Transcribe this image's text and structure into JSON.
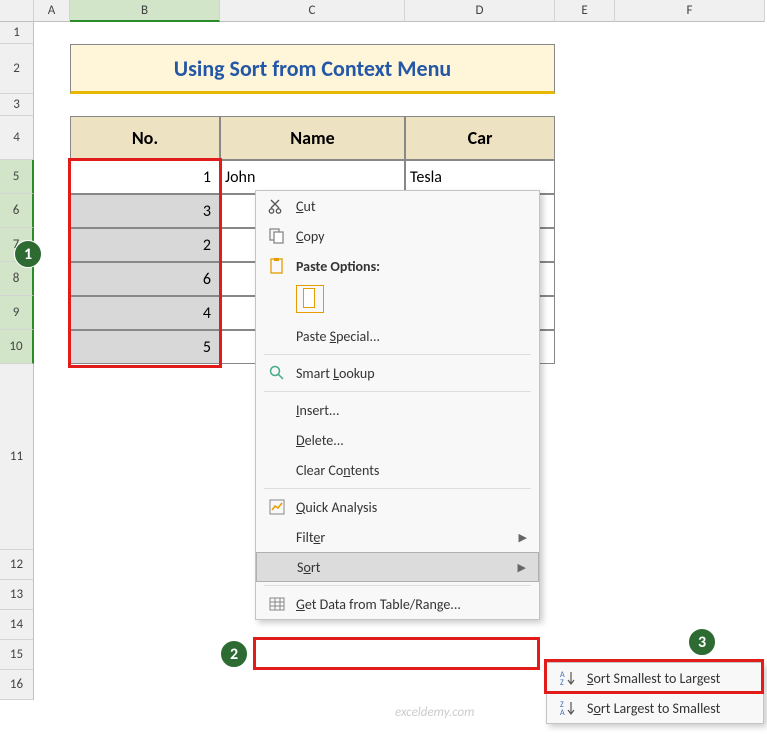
{
  "columns": [
    {
      "label": "",
      "w": 34
    },
    {
      "label": "A",
      "w": 36
    },
    {
      "label": "B",
      "w": 150,
      "sel": true
    },
    {
      "label": "C",
      "w": 185
    },
    {
      "label": "D",
      "w": 150
    },
    {
      "label": "E",
      "w": 60
    },
    {
      "label": "F",
      "w": 150
    }
  ],
  "rows": [
    {
      "n": 1,
      "h": 22
    },
    {
      "n": 2,
      "h": 50
    },
    {
      "n": 3,
      "h": 22
    },
    {
      "n": 4,
      "h": 44
    },
    {
      "n": 5,
      "h": 34,
      "sel": true
    },
    {
      "n": 6,
      "h": 34,
      "sel": true
    },
    {
      "n": 7,
      "h": 34,
      "sel": true
    },
    {
      "n": 8,
      "h": 34,
      "sel": true
    },
    {
      "n": 9,
      "h": 34,
      "sel": true
    },
    {
      "n": 10,
      "h": 34,
      "sel": true
    },
    {
      "n": 11,
      "h": 186
    },
    {
      "n": 12,
      "h": 30
    },
    {
      "n": 13,
      "h": 30
    },
    {
      "n": 14,
      "h": 30
    },
    {
      "n": 15,
      "h": 30
    },
    {
      "n": 16,
      "h": 30
    }
  ],
  "title": "Using Sort from Context Menu",
  "headers": {
    "no": "No.",
    "name": "Name",
    "car": "Car"
  },
  "data": {
    "nums": [
      1,
      3,
      2,
      6,
      4,
      5
    ],
    "names": [
      "John"
    ],
    "cars": [
      "Tesla"
    ]
  },
  "ctx": {
    "cut": "Cut",
    "copy": "Copy",
    "pasteopt": "Paste Options:",
    "pastespecial": "Paste Special...",
    "smartlookup": "Smart Lookup",
    "insert": "Insert...",
    "delete": "Delete...",
    "clear": "Clear Contents",
    "quick": "Quick Analysis",
    "filter": "Filter",
    "sort": "Sort",
    "getdata": "Get Data from Table/Range..."
  },
  "sub": {
    "s2l": "Sort Smallest to Largest",
    "l2s": "Sort Largest to Smallest"
  },
  "badges": {
    "b1": "1",
    "b2": "2",
    "b3": "3"
  },
  "watermark": "exceldemy.com"
}
